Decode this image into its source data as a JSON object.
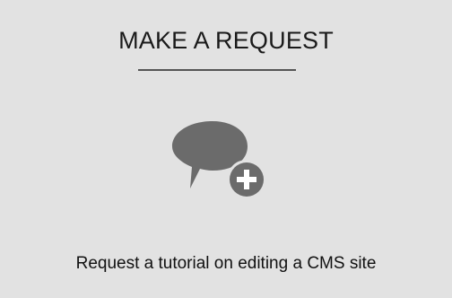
{
  "card": {
    "title": "MAKE A REQUEST",
    "icon": "chat-bubble-add-icon",
    "caption": "Request a tutorial on editing a CMS site"
  },
  "colors": {
    "background": "#e2e2e2",
    "icon": "#6b6b6b",
    "text": "#1a1a1a"
  }
}
